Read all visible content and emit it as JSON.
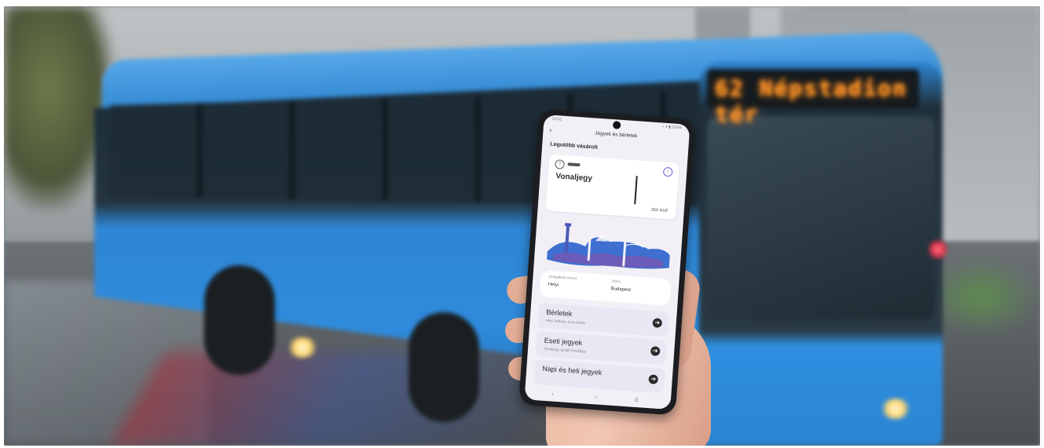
{
  "scene": {
    "bus_destination": "62 Népstadion tér"
  },
  "phone": {
    "status_bar": {
      "time": "12:52",
      "icons": "◐ ▾ ▮ 100%"
    },
    "header_title": "Jegyek és bérletek",
    "back_label": "‹",
    "section_title": "Legutóbb vásárolt",
    "ticket": {
      "name": "Vonaljegy",
      "price": "350 HUF",
      "qmark": "?",
      "info": "i"
    },
    "selector": {
      "label_left": "Szolgáltató körzet",
      "value_left": "Helyi",
      "label_right": "Város",
      "value_right": "Budapest"
    },
    "menu": [
      {
        "title": "Bérletek",
        "subtitle": "Havi, féléves, éves bérlet"
      },
      {
        "title": "Eseti jegyek",
        "subtitle": "Vonaljegy, gyűjtő vonaljegy"
      },
      {
        "title": "Napi és heti jegyek",
        "subtitle": ""
      }
    ],
    "menu_arrow": "➔",
    "navbar": {
      "back": "‹",
      "home": "○",
      "recent": "|||"
    }
  },
  "colors": {
    "bus_blue": "#2f8bdc",
    "screen_bg": "#f2f0f6",
    "menu_bg": "#ebe6f3",
    "accent": "#6a5ccf",
    "led_orange": "#ff9a2a"
  }
}
